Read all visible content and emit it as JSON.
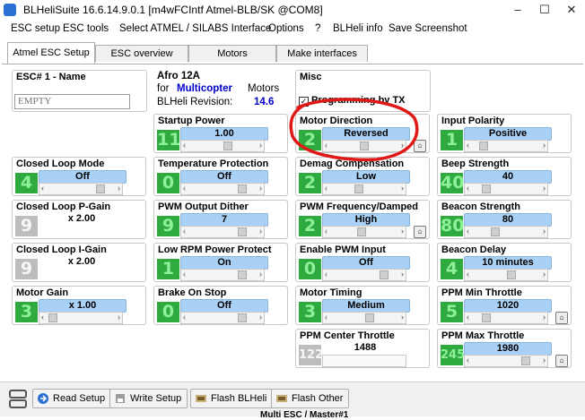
{
  "window": {
    "title": "BLHeliSuite 16.6.14.9.0.1  [m4wFCIntf Atmel-BLB/SK @COM8]"
  },
  "window_controls": {
    "minimize": "–",
    "maximize": "☐",
    "close": "✕"
  },
  "menu": [
    {
      "label": "ESC setup"
    },
    {
      "label": "ESC tools"
    },
    {
      "label": "Select ATMEL / SILABS Interface"
    },
    {
      "label": "Options"
    },
    {
      "label": "?"
    },
    {
      "label": "BLHeli info"
    },
    {
      "label": "Save Screenshot"
    }
  ],
  "tabs": [
    {
      "label": "Atmel ESC Setup",
      "active": true
    },
    {
      "label": "ESC overview"
    },
    {
      "label": "Motors"
    },
    {
      "label": "Make interfaces"
    }
  ],
  "esc_name": {
    "label": "ESC# 1 - Name",
    "value": "EMPTY"
  },
  "info": {
    "title": "Afro 12A",
    "for": "for",
    "mode": "Multicopter",
    "motors": "Motors",
    "rev_label": "BLHeli Revision:",
    "rev": "14.6"
  },
  "misc": {
    "label": "Misc",
    "checkbox": "Programming by TX",
    "checked": true
  },
  "params": [
    {
      "id": "startup-power",
      "label": "Startup Power",
      "num": "11",
      "value": "1.00",
      "pos": 0.6
    },
    {
      "id": "motor-direction",
      "label": "Motor Direction",
      "num": "2",
      "value": "Reversed",
      "pos": 0.5
    },
    {
      "id": "input-polarity",
      "label": "Input Polarity",
      "num": "1",
      "value": "Positive",
      "pos": 0.1
    },
    {
      "id": "closed-loop-mode",
      "label": "Closed Loop Mode",
      "num": "4",
      "value": "Off",
      "pos": 0.85
    },
    {
      "id": "temperature-protection",
      "label": "Temperature Protection",
      "num": "0",
      "value": "Off",
      "pos": 0.85
    },
    {
      "id": "demag-compensation",
      "label": "Demag Compensation",
      "num": "2",
      "value": "Low",
      "pos": 0.4
    },
    {
      "id": "beep-strength",
      "label": "Beep Strength",
      "num": "40",
      "value": "40",
      "pos": 0.15
    },
    {
      "id": "closed-loop-p-gain",
      "label": "Closed Loop P-Gain",
      "num": "9",
      "value": "x 2.00",
      "pos": 0.0,
      "disabled": true
    },
    {
      "id": "pwm-output-dither",
      "label": "PWM Output Dither",
      "num": "9",
      "value": "7",
      "pos": 0.85
    },
    {
      "id": "pwm-frequency-damped",
      "label": "PWM Frequency/Damped",
      "num": "2",
      "value": "High",
      "pos": 0.45
    },
    {
      "id": "beacon-strength",
      "label": "Beacon Strength",
      "num": "80",
      "value": "80",
      "pos": 0.3
    },
    {
      "id": "closed-loop-i-gain",
      "label": "Closed Loop I-Gain",
      "num": "9",
      "value": "x 2.00",
      "pos": 0.0,
      "disabled": true
    },
    {
      "id": "low-rpm-power-protect",
      "label": "Low RPM Power Protect",
      "num": "1",
      "value": "On",
      "pos": 0.85
    },
    {
      "id": "enable-pwm-input",
      "label": "Enable PWM Input",
      "num": "0",
      "value": "Off",
      "pos": 0.85
    },
    {
      "id": "beacon-delay",
      "label": "Beacon Delay",
      "num": "4",
      "value": "10 minutes",
      "pos": 0.6
    },
    {
      "id": "motor-gain",
      "label": "Motor Gain",
      "num": "3",
      "value": "x 1.00",
      "pos": 0.0
    },
    {
      "id": "brake-on-stop",
      "label": "Brake On Stop",
      "num": "0",
      "value": "Off",
      "pos": 0.85
    },
    {
      "id": "motor-timing",
      "label": "Motor Timing",
      "num": "3",
      "value": "Medium",
      "pos": 0.6
    },
    {
      "id": "ppm-min-throttle",
      "label": "PPM Min Throttle",
      "num": "5",
      "value": "1020",
      "pos": 0.15
    },
    {
      "id": "ppm-center-throttle",
      "label": "PPM Center Throttle",
      "num": "122",
      "value": "1488",
      "pos": 0.0,
      "disabled": true
    },
    {
      "id": "ppm-max-throttle",
      "label": "PPM Max Throttle",
      "num": "245",
      "value": "1980",
      "pos": 0.85
    }
  ],
  "buttons": [
    {
      "label": "Read Setup"
    },
    {
      "label": "Write Setup"
    },
    {
      "label": "Flash BLHeli"
    },
    {
      "label": "Flash Other"
    }
  ],
  "status": "Multi ESC / Master#1",
  "colors": {
    "accent_blue": "#0000cc",
    "value_bg": "#a9d1f5",
    "num_green": "#2faa3f",
    "annotation_red": "#e01818"
  }
}
